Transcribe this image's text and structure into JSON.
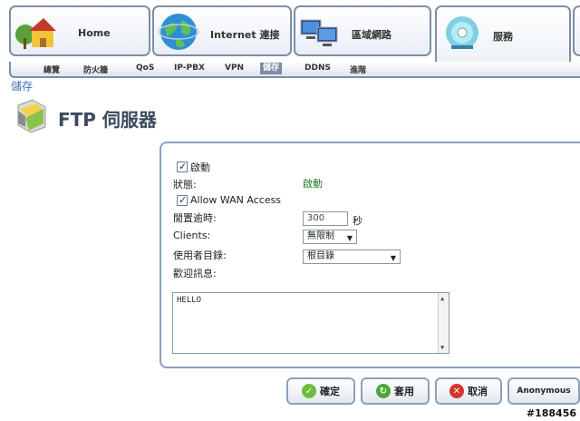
{
  "tabs": [
    {
      "label": "Home"
    },
    {
      "label": "Internet 連接"
    },
    {
      "label": "區域網路"
    },
    {
      "label": "服務"
    }
  ],
  "subnav": [
    "總覽",
    "防火牆",
    "QoS",
    "IP-PBX",
    "VPN",
    "儲存",
    "DDNS",
    "進階"
  ],
  "breadcrumb": "儲存",
  "page_title": "FTP 伺服器",
  "form": {
    "enable_label": "啟動",
    "status_label": "狀態:",
    "status_value": "啟動",
    "allow_wan_label": "Allow WAN Access",
    "idle_timeout_label": "閒置逾時:",
    "idle_timeout_value": "300",
    "idle_timeout_unit": "秒",
    "clients_label": "Clients:",
    "clients_value": "無限制",
    "user_dir_label": "使用者目錄:",
    "user_dir_value": "根目錄",
    "welcome_label": "歡迎訊息:",
    "welcome_text": "HELLO"
  },
  "buttons": {
    "ok": "確定",
    "apply": "套用",
    "cancel": "取消",
    "anonymous": "Anonymous"
  },
  "watermark": "#188456",
  "colors": {
    "status_green": "#1f7a1f",
    "link_blue": "#3f6fb0",
    "border": "#8ca0ba"
  }
}
